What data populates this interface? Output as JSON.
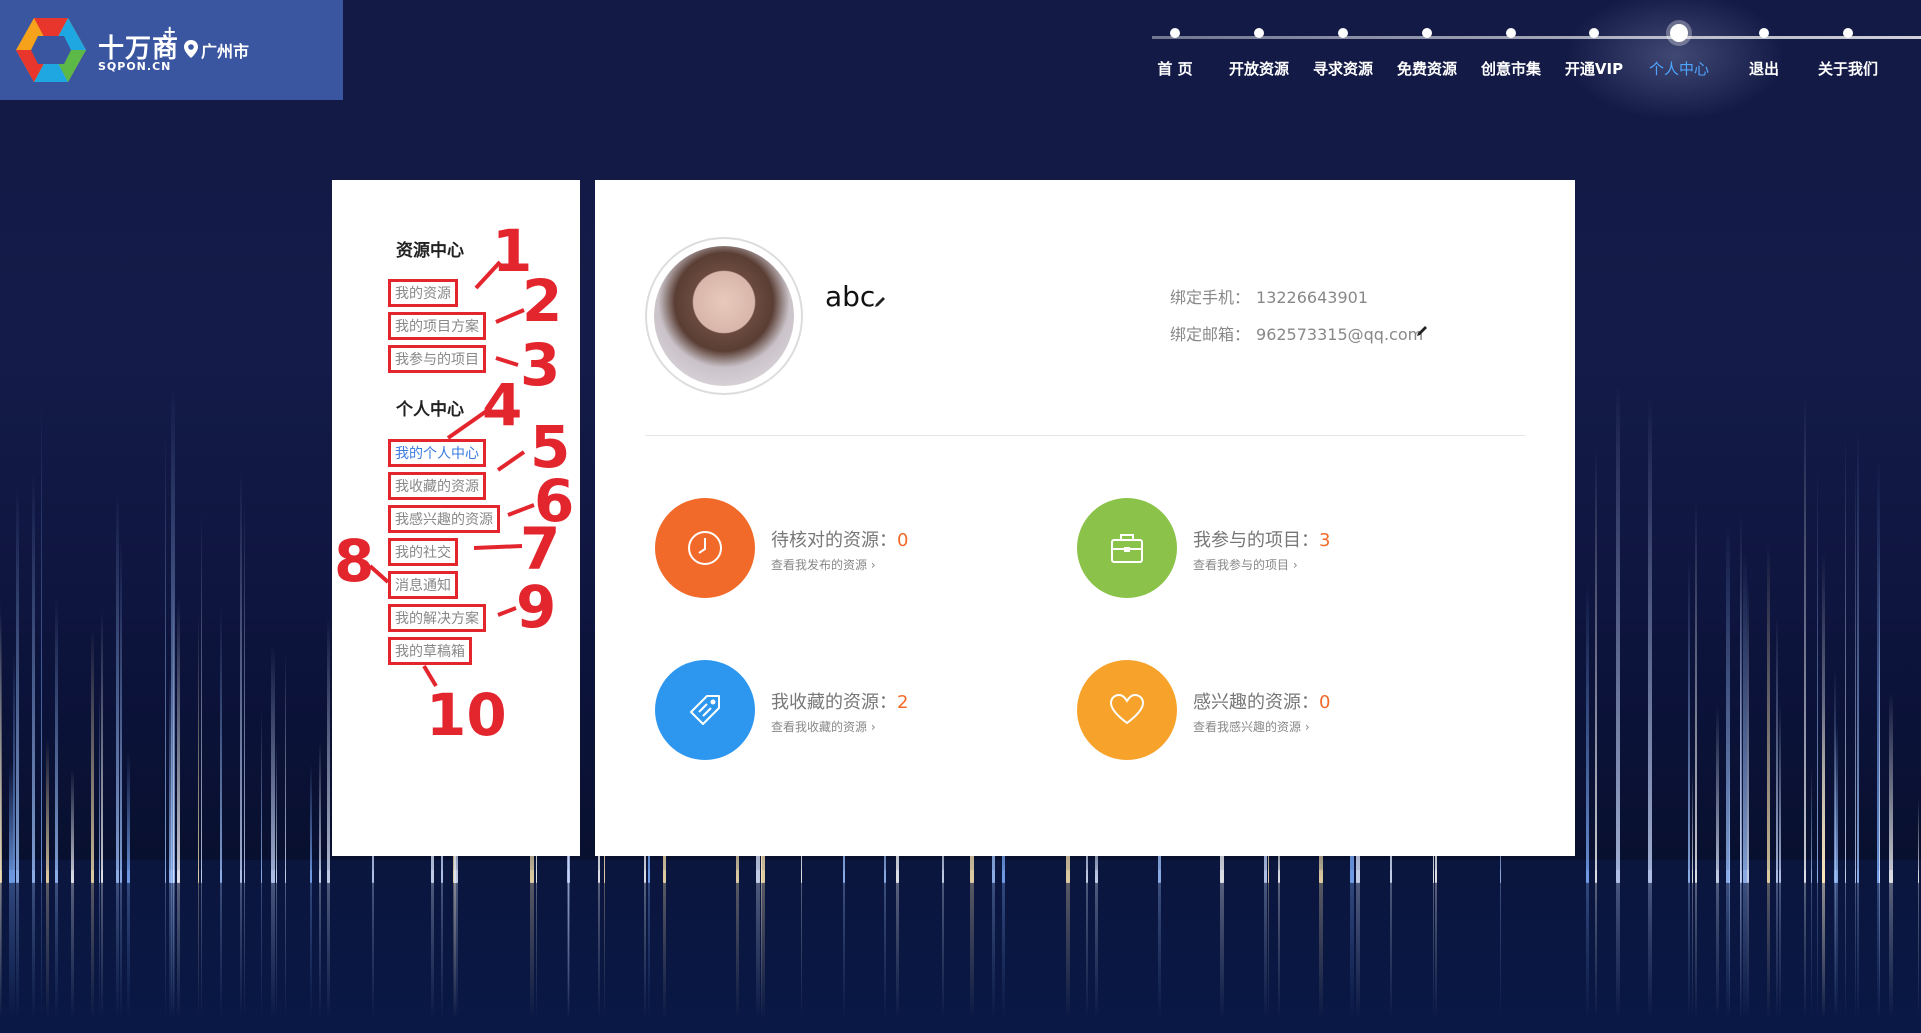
{
  "brand": {
    "name": "十万商",
    "plus": "+",
    "domain": "SQPON.CN",
    "city": "广州市",
    "logo_colors": [
      "#f7a21b",
      "#e8362c",
      "#1fa7e1",
      "#5cb847"
    ]
  },
  "nav": {
    "items": [
      {
        "label": "首 页"
      },
      {
        "label": "开放资源"
      },
      {
        "label": "寻求资源"
      },
      {
        "label": "免费资源"
      },
      {
        "label": "创意市集"
      },
      {
        "label": "开通VIP"
      },
      {
        "label": "个人中心",
        "active": true
      },
      {
        "label": "退出"
      },
      {
        "label": "关于我们"
      }
    ],
    "active_color": "#4ea6ff"
  },
  "sidebar": {
    "sections": [
      {
        "title": "资源中心",
        "items": [
          {
            "label": "我的资源",
            "marker": "1"
          },
          {
            "label": "我的项目方案",
            "marker": "2"
          },
          {
            "label": "我参与的项目",
            "marker": "3"
          }
        ]
      },
      {
        "title": "个人中心",
        "marker": "4",
        "items": [
          {
            "label": "我的个人中心",
            "marker": "5",
            "active": true
          },
          {
            "label": "我收藏的资源",
            "marker": "6"
          },
          {
            "label": "我感兴趣的资源",
            "marker": "7"
          },
          {
            "label": "我的社交",
            "marker": "8"
          },
          {
            "label": "消息通知",
            "marker": "9"
          },
          {
            "label": "我的解决方案",
            "marker": "10"
          },
          {
            "label": "我的草稿箱",
            "marker": ""
          }
        ]
      }
    ],
    "annotation_color": "#e3262e"
  },
  "profile": {
    "username": "abc",
    "phone_label": "绑定手机：",
    "phone": "13226643901",
    "email_label": "绑定邮箱：",
    "email": "962573315@qq.com"
  },
  "stats": [
    {
      "label": "待核对的资源：",
      "value": "0",
      "link": "查看我发布的资源 ›",
      "color": "#f26a2a",
      "icon": "clock-icon"
    },
    {
      "label": "我参与的项目：",
      "value": "3",
      "link": "查看我参与的项目 ›",
      "color": "#8bc34a",
      "icon": "briefcase-icon"
    },
    {
      "label": "我收藏的资源：",
      "value": "2",
      "link": "查看我收藏的资源 ›",
      "color": "#2d97f0",
      "icon": "tag-icon"
    },
    {
      "label": "感兴趣的资源：",
      "value": "0",
      "link": "查看我感兴趣的资源 ›",
      "color": "#f7a32b",
      "icon": "heart-icon"
    }
  ]
}
